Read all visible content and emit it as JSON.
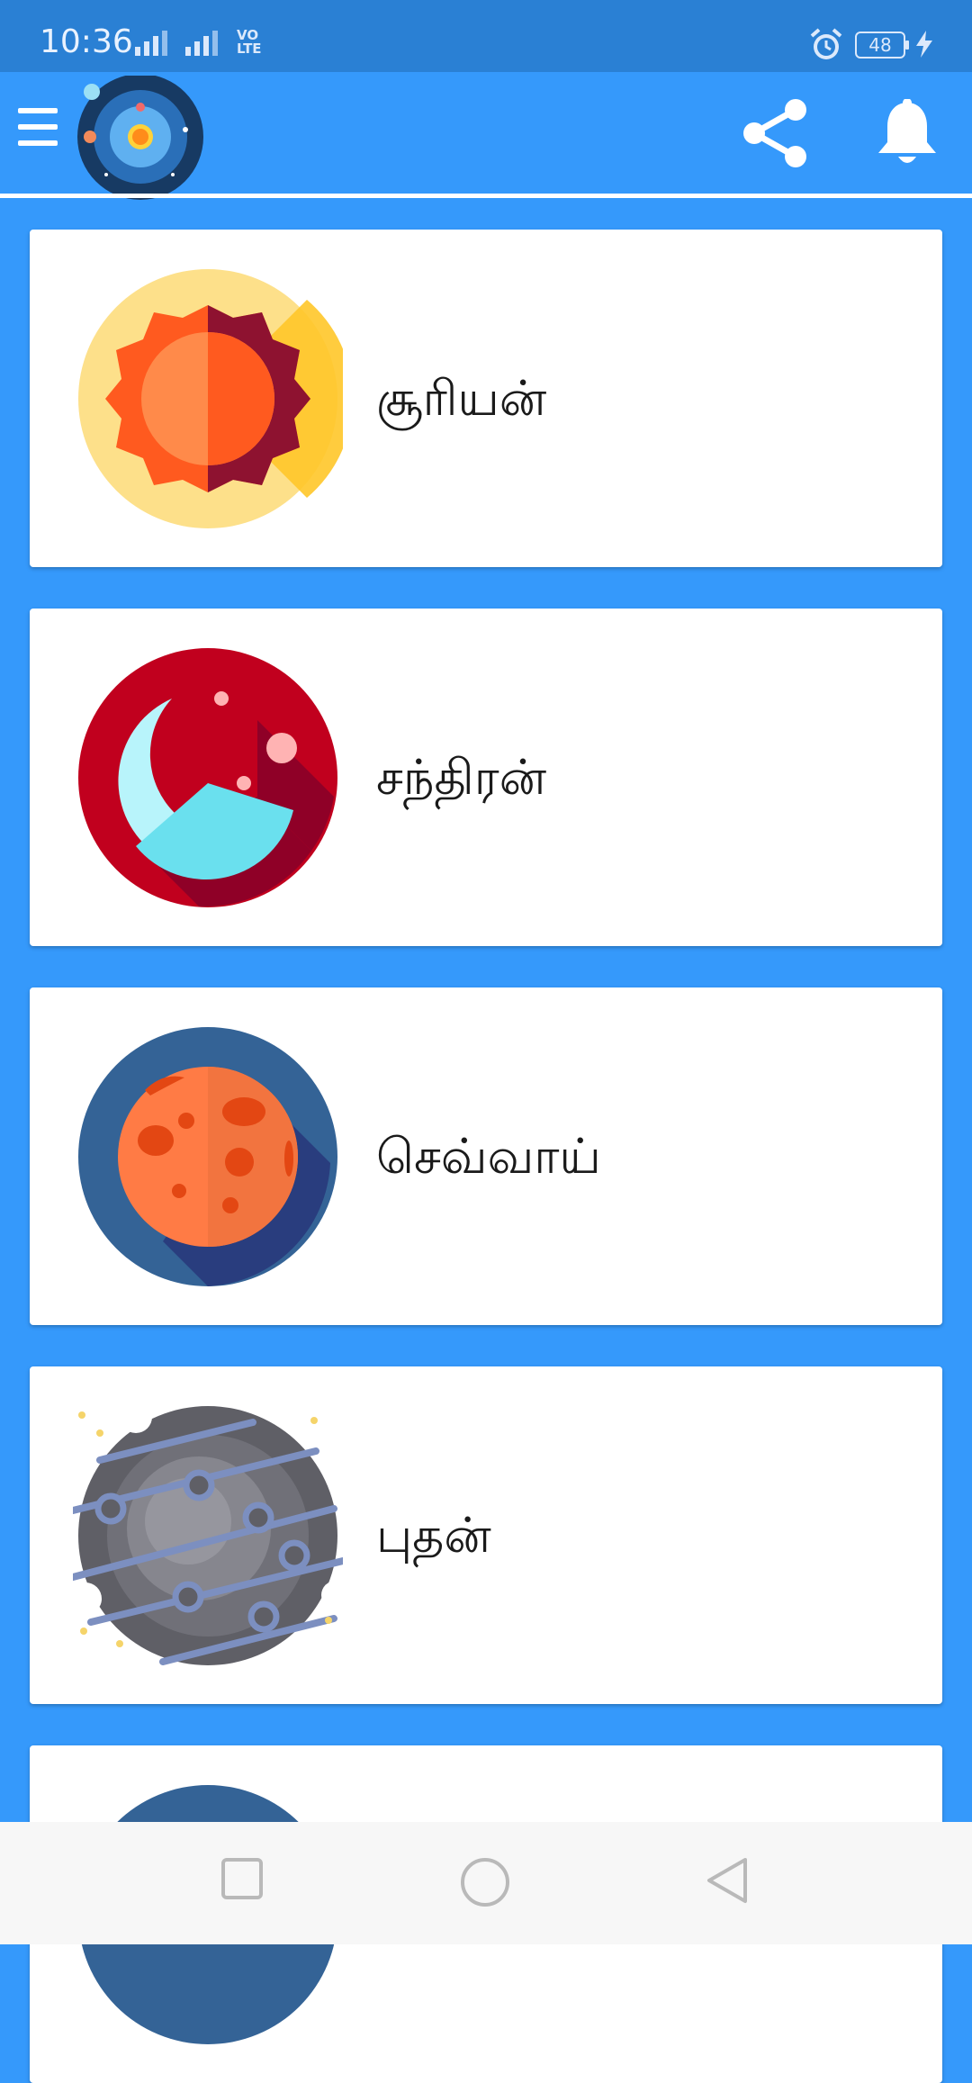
{
  "status_bar": {
    "time": "10:36",
    "network_label": "VO\nLTE",
    "battery_level": "48"
  },
  "app_bar": {
    "menu_icon": "hamburger-menu-icon",
    "logo": "solar-system-logo",
    "share_icon": "share-icon",
    "notification_icon": "bell-icon"
  },
  "planets": [
    {
      "name": "சூரியன்",
      "icon": "sun-icon"
    },
    {
      "name": "சந்திரன்",
      "icon": "moon-icon"
    },
    {
      "name": "செவ்வாய்",
      "icon": "mars-icon"
    },
    {
      "name": "புதன்",
      "icon": "mercury-icon"
    },
    {
      "name": "",
      "icon": "planet-icon"
    }
  ],
  "nav_bar": {
    "recents_icon": "square-recents-icon",
    "home_icon": "circle-home-icon",
    "back_icon": "triangle-back-icon"
  },
  "colors": {
    "background": "#3599fb",
    "status_bar": "#2a80d4",
    "card": "#ffffff"
  }
}
